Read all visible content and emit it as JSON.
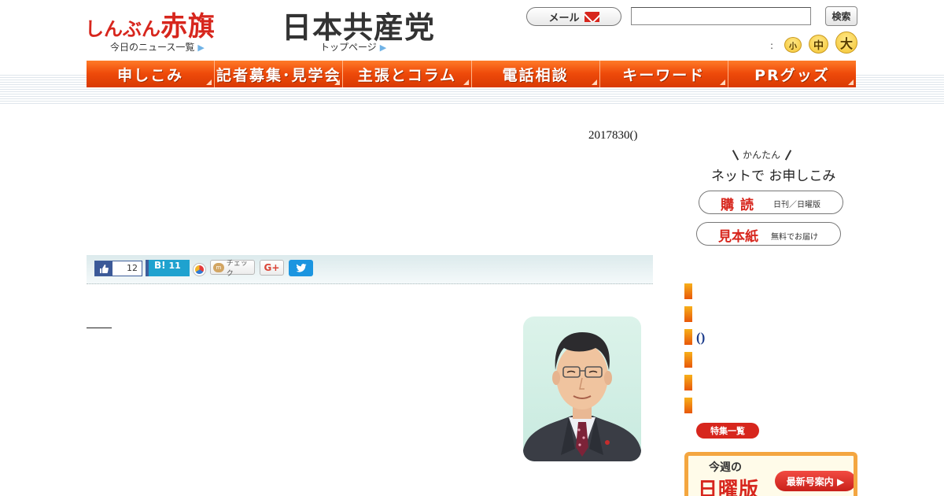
{
  "header": {
    "logo_kana": "しんぶん",
    "logo_kanji": "赤旗",
    "news_link": "今日のニュース一覧",
    "jcp_logo": "日本共産党",
    "top_link": "トップページ",
    "mail_label": "メール",
    "search_value": "",
    "search_button": "検索",
    "fontsize_colon": ":",
    "fontsize_small": "小",
    "fontsize_medium": "中",
    "fontsize_large": "大"
  },
  "nav": {
    "items": [
      "申しこみ",
      "記者募集･見学会",
      "主張とコラム",
      "電話相談",
      "キーワード",
      "PRグッズ"
    ]
  },
  "article": {
    "date": "2017830()"
  },
  "share": {
    "like_count": "12",
    "hatena_label": "B!",
    "hatena_count": "11",
    "mixi_label": "チェック",
    "gplus_label": "G+"
  },
  "sidebar": {
    "net_small": "かんたん",
    "net_main": "ネットで お申しこみ",
    "koudoku_big": "購読",
    "koudoku_small": "日刊／日曜版",
    "mihon_big": "見本紙",
    "mihon_small": "無料でお届け",
    "paren_link": "()",
    "tokushu_button": "特集一覧",
    "promo_kon": "今週の",
    "promo_nichi": "日曜版",
    "promo_button": "最新号案内 ▶"
  },
  "colors": {
    "brand_red": "#d7261d",
    "nav_orange": "#ee4a0a",
    "link_blue": "#1a3a8a"
  }
}
